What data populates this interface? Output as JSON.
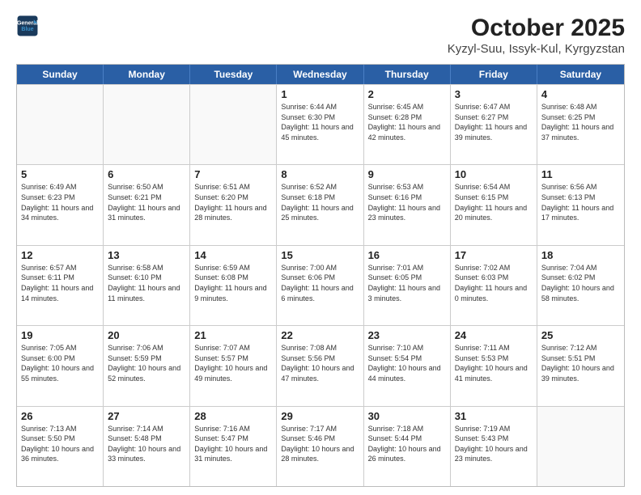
{
  "header": {
    "logo_line1": "General",
    "logo_line2": "Blue",
    "title": "October 2025",
    "subtitle": "Kyzyl-Suu, Issyk-Kul, Kyrgyzstan"
  },
  "days_of_week": [
    "Sunday",
    "Monday",
    "Tuesday",
    "Wednesday",
    "Thursday",
    "Friday",
    "Saturday"
  ],
  "rows": [
    [
      {
        "day": "",
        "info": "",
        "empty": true
      },
      {
        "day": "",
        "info": "",
        "empty": true
      },
      {
        "day": "",
        "info": "",
        "empty": true
      },
      {
        "day": "1",
        "info": "Sunrise: 6:44 AM\nSunset: 6:30 PM\nDaylight: 11 hours and 45 minutes."
      },
      {
        "day": "2",
        "info": "Sunrise: 6:45 AM\nSunset: 6:28 PM\nDaylight: 11 hours and 42 minutes."
      },
      {
        "day": "3",
        "info": "Sunrise: 6:47 AM\nSunset: 6:27 PM\nDaylight: 11 hours and 39 minutes."
      },
      {
        "day": "4",
        "info": "Sunrise: 6:48 AM\nSunset: 6:25 PM\nDaylight: 11 hours and 37 minutes."
      }
    ],
    [
      {
        "day": "5",
        "info": "Sunrise: 6:49 AM\nSunset: 6:23 PM\nDaylight: 11 hours and 34 minutes."
      },
      {
        "day": "6",
        "info": "Sunrise: 6:50 AM\nSunset: 6:21 PM\nDaylight: 11 hours and 31 minutes."
      },
      {
        "day": "7",
        "info": "Sunrise: 6:51 AM\nSunset: 6:20 PM\nDaylight: 11 hours and 28 minutes."
      },
      {
        "day": "8",
        "info": "Sunrise: 6:52 AM\nSunset: 6:18 PM\nDaylight: 11 hours and 25 minutes."
      },
      {
        "day": "9",
        "info": "Sunrise: 6:53 AM\nSunset: 6:16 PM\nDaylight: 11 hours and 23 minutes."
      },
      {
        "day": "10",
        "info": "Sunrise: 6:54 AM\nSunset: 6:15 PM\nDaylight: 11 hours and 20 minutes."
      },
      {
        "day": "11",
        "info": "Sunrise: 6:56 AM\nSunset: 6:13 PM\nDaylight: 11 hours and 17 minutes."
      }
    ],
    [
      {
        "day": "12",
        "info": "Sunrise: 6:57 AM\nSunset: 6:11 PM\nDaylight: 11 hours and 14 minutes."
      },
      {
        "day": "13",
        "info": "Sunrise: 6:58 AM\nSunset: 6:10 PM\nDaylight: 11 hours and 11 minutes."
      },
      {
        "day": "14",
        "info": "Sunrise: 6:59 AM\nSunset: 6:08 PM\nDaylight: 11 hours and 9 minutes."
      },
      {
        "day": "15",
        "info": "Sunrise: 7:00 AM\nSunset: 6:06 PM\nDaylight: 11 hours and 6 minutes."
      },
      {
        "day": "16",
        "info": "Sunrise: 7:01 AM\nSunset: 6:05 PM\nDaylight: 11 hours and 3 minutes."
      },
      {
        "day": "17",
        "info": "Sunrise: 7:02 AM\nSunset: 6:03 PM\nDaylight: 11 hours and 0 minutes."
      },
      {
        "day": "18",
        "info": "Sunrise: 7:04 AM\nSunset: 6:02 PM\nDaylight: 10 hours and 58 minutes."
      }
    ],
    [
      {
        "day": "19",
        "info": "Sunrise: 7:05 AM\nSunset: 6:00 PM\nDaylight: 10 hours and 55 minutes."
      },
      {
        "day": "20",
        "info": "Sunrise: 7:06 AM\nSunset: 5:59 PM\nDaylight: 10 hours and 52 minutes."
      },
      {
        "day": "21",
        "info": "Sunrise: 7:07 AM\nSunset: 5:57 PM\nDaylight: 10 hours and 49 minutes."
      },
      {
        "day": "22",
        "info": "Sunrise: 7:08 AM\nSunset: 5:56 PM\nDaylight: 10 hours and 47 minutes."
      },
      {
        "day": "23",
        "info": "Sunrise: 7:10 AM\nSunset: 5:54 PM\nDaylight: 10 hours and 44 minutes."
      },
      {
        "day": "24",
        "info": "Sunrise: 7:11 AM\nSunset: 5:53 PM\nDaylight: 10 hours and 41 minutes."
      },
      {
        "day": "25",
        "info": "Sunrise: 7:12 AM\nSunset: 5:51 PM\nDaylight: 10 hours and 39 minutes."
      }
    ],
    [
      {
        "day": "26",
        "info": "Sunrise: 7:13 AM\nSunset: 5:50 PM\nDaylight: 10 hours and 36 minutes."
      },
      {
        "day": "27",
        "info": "Sunrise: 7:14 AM\nSunset: 5:48 PM\nDaylight: 10 hours and 33 minutes."
      },
      {
        "day": "28",
        "info": "Sunrise: 7:16 AM\nSunset: 5:47 PM\nDaylight: 10 hours and 31 minutes."
      },
      {
        "day": "29",
        "info": "Sunrise: 7:17 AM\nSunset: 5:46 PM\nDaylight: 10 hours and 28 minutes."
      },
      {
        "day": "30",
        "info": "Sunrise: 7:18 AM\nSunset: 5:44 PM\nDaylight: 10 hours and 26 minutes."
      },
      {
        "day": "31",
        "info": "Sunrise: 7:19 AM\nSunset: 5:43 PM\nDaylight: 10 hours and 23 minutes."
      },
      {
        "day": "",
        "info": "",
        "empty": true
      }
    ]
  ]
}
